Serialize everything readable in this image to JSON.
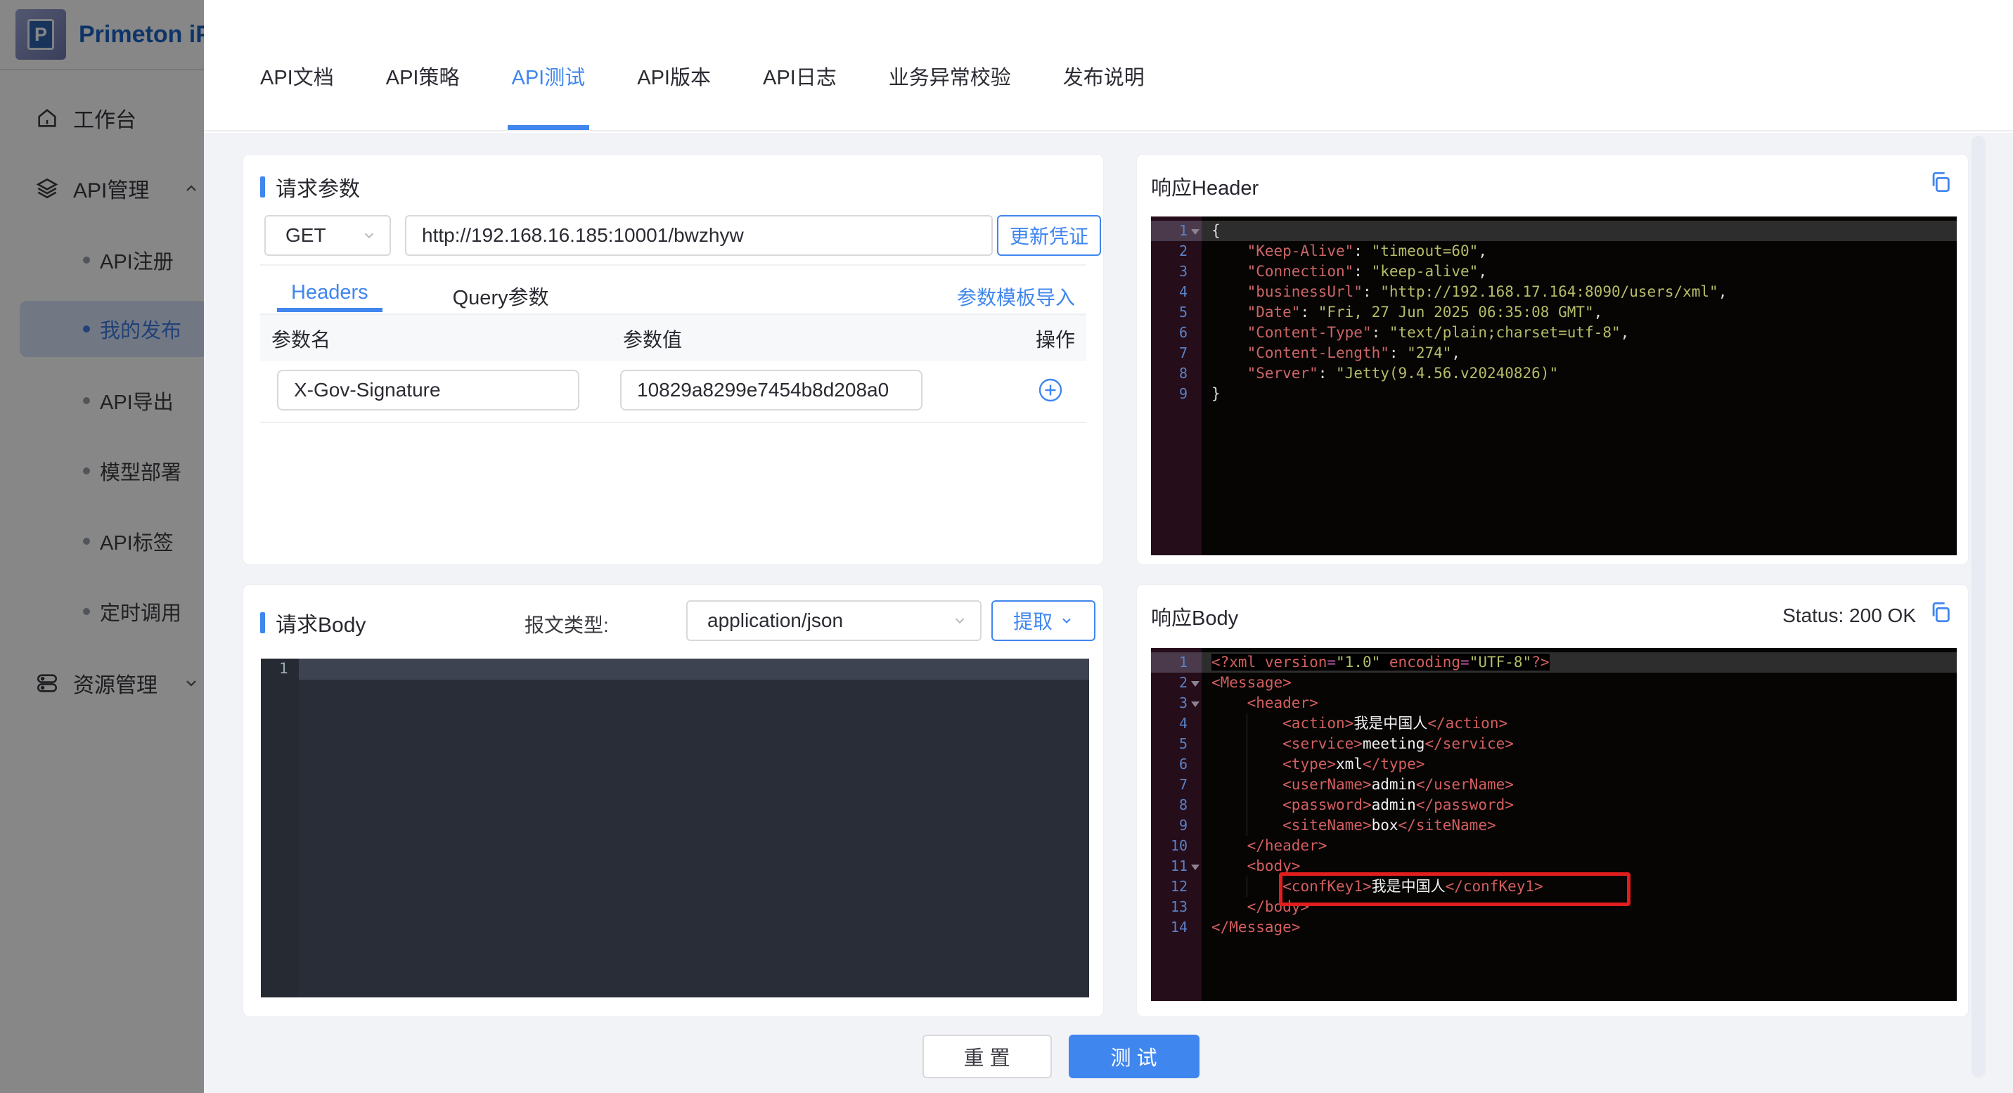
{
  "app": {
    "brand": "Primeton iP"
  },
  "colors": {
    "accent": "#4086ef",
    "annotation_red": "#e11d1d",
    "code_key": "#cb6666",
    "code_value": "#b5bd68",
    "code_tag": "#d25f5f"
  },
  "sidebar": {
    "workbench": "工作台",
    "api_mgmt": "API管理",
    "api_mgmt_children": [
      "API注册",
      "我的发布",
      "API导出",
      "模型部署",
      "API标签",
      "定时调用"
    ],
    "active_child": "我的发布",
    "resource_mgmt": "资源管理"
  },
  "modal": {
    "tabs": [
      "API文档",
      "API策略",
      "API测试",
      "API版本",
      "API日志",
      "业务异常校验",
      "发布说明"
    ],
    "active_tab": "API测试",
    "request_params": {
      "section_title": "请求参数",
      "method": "GET",
      "url": "http://192.168.16.185:10001/bwzhyw",
      "update_credential_label": "更新凭证",
      "subtab_headers": "Headers",
      "subtab_query": "Query参数",
      "template_import_label": "参数模板导入",
      "table_headers": {
        "name": "参数名",
        "value": "参数值",
        "action": "操作"
      },
      "row": {
        "name": "X-Gov-Signature",
        "value": "10829a8299e7454b8d208a0"
      }
    },
    "request_body": {
      "section_title": "请求Body",
      "content_type_label": "报文类型:",
      "content_type_value": "application/json",
      "extract_label": "提取",
      "editor_line_no": "1"
    },
    "response_header": {
      "section_title": "响应Header",
      "lines": [
        {
          "n": 1,
          "f": 1,
          "a": 1,
          "seg": [
            [
              "p",
              "{"
            ]
          ]
        },
        {
          "n": 2,
          "seg": [
            [
              "p",
              "    "
            ],
            [
              "k",
              "\"Keep-Alive\""
            ],
            [
              "p",
              ": "
            ],
            [
              "v",
              "\"timeout=60\""
            ],
            [
              "p",
              ","
            ]
          ]
        },
        {
          "n": 3,
          "seg": [
            [
              "p",
              "    "
            ],
            [
              "k",
              "\"Connection\""
            ],
            [
              "p",
              ": "
            ],
            [
              "v",
              "\"keep-alive\""
            ],
            [
              "p",
              ","
            ]
          ]
        },
        {
          "n": 4,
          "seg": [
            [
              "p",
              "    "
            ],
            [
              "k",
              "\"businessUrl\""
            ],
            [
              "p",
              ": "
            ],
            [
              "v",
              "\"http://192.168.17.164:8090/users/xml\""
            ],
            [
              "p",
              ","
            ]
          ]
        },
        {
          "n": 5,
          "seg": [
            [
              "p",
              "    "
            ],
            [
              "k",
              "\"Date\""
            ],
            [
              "p",
              ": "
            ],
            [
              "v",
              "\"Fri, 27 Jun 2025 06:35:08 GMT\""
            ],
            [
              "p",
              ","
            ]
          ]
        },
        {
          "n": 6,
          "seg": [
            [
              "p",
              "    "
            ],
            [
              "k",
              "\"Content-Type\""
            ],
            [
              "p",
              ": "
            ],
            [
              "v",
              "\"text/plain;charset=utf-8\""
            ],
            [
              "p",
              ","
            ]
          ]
        },
        {
          "n": 7,
          "seg": [
            [
              "p",
              "    "
            ],
            [
              "k",
              "\"Content-Length\""
            ],
            [
              "p",
              ": "
            ],
            [
              "v",
              "\"274\""
            ],
            [
              "p",
              ","
            ]
          ]
        },
        {
          "n": 8,
          "seg": [
            [
              "p",
              "    "
            ],
            [
              "k",
              "\"Server\""
            ],
            [
              "p",
              ": "
            ],
            [
              "v",
              "\"Jetty(9.4.56.v20240826)\""
            ]
          ]
        },
        {
          "n": 9,
          "seg": [
            [
              "p",
              "}"
            ]
          ]
        }
      ]
    },
    "response_body": {
      "section_title": "响应Body",
      "status_text": "Status: 200 OK",
      "lines": [
        {
          "n": 1,
          "a": 1,
          "s": 1,
          "seg": [
            [
              "t",
              "<?xml version"
            ],
            [
              "e",
              "="
            ],
            [
              "v",
              "\"1.0\""
            ],
            [
              "t",
              " encoding"
            ],
            [
              "e",
              "="
            ],
            [
              "v",
              "\"UTF-8\""
            ],
            [
              "t",
              "?>"
            ]
          ]
        },
        {
          "n": 2,
          "f": 1,
          "seg": [
            [
              "t",
              "<Message>"
            ]
          ]
        },
        {
          "n": 3,
          "f": 1,
          "seg": [
            [
              "p",
              "    "
            ],
            [
              "t",
              "<header>"
            ]
          ]
        },
        {
          "n": 4,
          "seg": [
            [
              "p",
              "        "
            ],
            [
              "t",
              "<action>"
            ],
            [
              "x",
              "我是中国人"
            ],
            [
              "t",
              "</action>"
            ]
          ]
        },
        {
          "n": 5,
          "seg": [
            [
              "p",
              "        "
            ],
            [
              "t",
              "<service>"
            ],
            [
              "x",
              "meeting"
            ],
            [
              "t",
              "</service>"
            ]
          ]
        },
        {
          "n": 6,
          "seg": [
            [
              "p",
              "        "
            ],
            [
              "t",
              "<type>"
            ],
            [
              "x",
              "xml"
            ],
            [
              "t",
              "</type>"
            ]
          ]
        },
        {
          "n": 7,
          "seg": [
            [
              "p",
              "        "
            ],
            [
              "t",
              "<userName>"
            ],
            [
              "x",
              "admin"
            ],
            [
              "t",
              "</userName>"
            ]
          ]
        },
        {
          "n": 8,
          "seg": [
            [
              "p",
              "        "
            ],
            [
              "t",
              "<password>"
            ],
            [
              "x",
              "admin"
            ],
            [
              "t",
              "</password>"
            ]
          ]
        },
        {
          "n": 9,
          "seg": [
            [
              "p",
              "        "
            ],
            [
              "t",
              "<siteName>"
            ],
            [
              "x",
              "box"
            ],
            [
              "t",
              "</siteName>"
            ]
          ]
        },
        {
          "n": 10,
          "seg": [
            [
              "p",
              "    "
            ],
            [
              "t",
              "</header>"
            ]
          ]
        },
        {
          "n": 11,
          "f": 1,
          "seg": [
            [
              "p",
              "    "
            ],
            [
              "t",
              "<body>"
            ]
          ]
        },
        {
          "n": 12,
          "seg": [
            [
              "p",
              "        "
            ],
            [
              "t",
              "<confKey1>"
            ],
            [
              "x",
              "我是中国人"
            ],
            [
              "t",
              "</confKey1>"
            ]
          ]
        },
        {
          "n": 13,
          "seg": [
            [
              "p",
              "    "
            ],
            [
              "t",
              "</body>"
            ]
          ]
        },
        {
          "n": 14,
          "seg": [
            [
              "t",
              "</Message>"
            ]
          ]
        }
      ]
    },
    "footer": {
      "reset_label": "重 置",
      "test_label": "测 试"
    }
  }
}
